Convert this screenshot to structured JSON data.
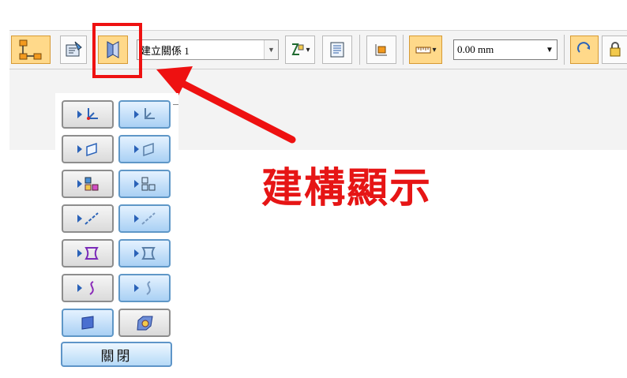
{
  "toolbar": {
    "relation_combo": {
      "value": "建立關係 1",
      "arrow": "▼"
    },
    "distance_combo": {
      "value": "0.00 mm",
      "arrow": "▼"
    },
    "small_dropdown_arrow": "▾"
  },
  "panel": {
    "close_label": "關閉"
  },
  "annotation": {
    "callout_text": "建構顯示",
    "color": "#e61515"
  },
  "icons": [
    "assembly-tree-icon",
    "properties-icon",
    "construction-display-icon",
    "relationship-type-icon",
    "list-icon",
    "part-icon",
    "measure-icon",
    "redo-icon",
    "lock-icon",
    "coordinate-system-icon",
    "plane-icon",
    "feature-icon",
    "line-icon",
    "sketch-icon",
    "curve-icon",
    "surface-icon",
    "part-view-icon"
  ]
}
